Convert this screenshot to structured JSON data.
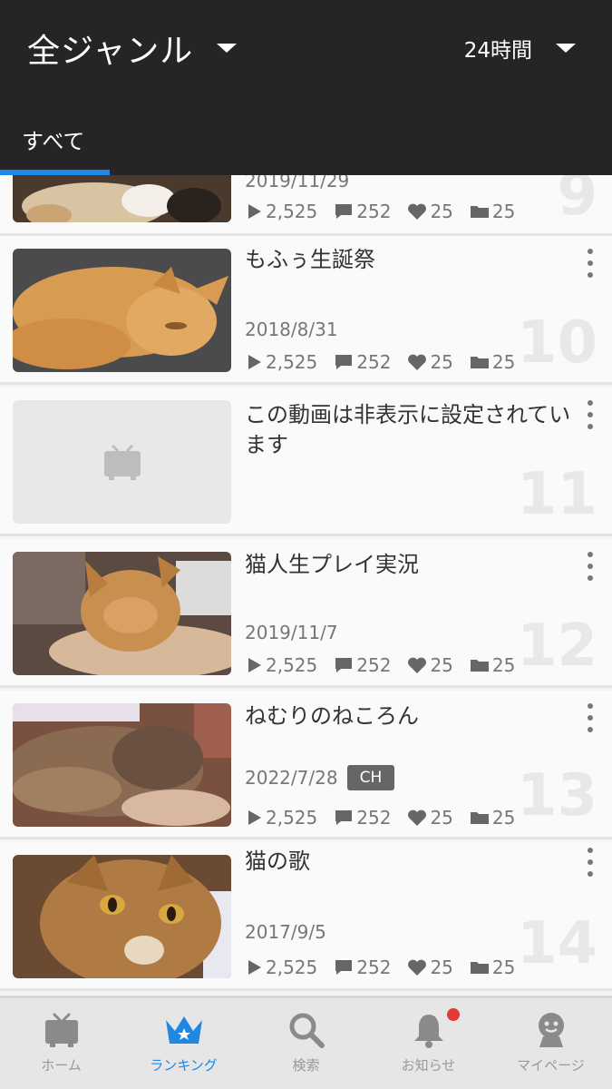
{
  "header": {
    "genre": "全ジャンル",
    "period": "24時間",
    "tab_all": "すべて"
  },
  "items": [
    {
      "rank": "9",
      "title": "",
      "date": "2019/11/29",
      "views": "2,525",
      "comments": "252",
      "likes": "25",
      "mylists": "25"
    },
    {
      "rank": "10",
      "title": "もふぅ生誕祭",
      "date": "2018/8/31",
      "views": "2,525",
      "comments": "252",
      "likes": "25",
      "mylists": "25"
    },
    {
      "rank": "11",
      "title": "この動画は非表示に設定されています"
    },
    {
      "rank": "12",
      "title": "猫人生プレイ実況",
      "date": "2019/11/7",
      "views": "2,525",
      "comments": "252",
      "likes": "25",
      "mylists": "25"
    },
    {
      "rank": "13",
      "title": "ねむりのねころん",
      "date": "2022/7/28",
      "badge": "CH",
      "views": "2,525",
      "comments": "252",
      "likes": "25",
      "mylists": "25"
    },
    {
      "rank": "14",
      "title": "猫の歌",
      "date": "2017/9/5",
      "views": "2,525",
      "comments": "252",
      "likes": "25",
      "mylists": "25"
    }
  ],
  "nav": {
    "home": "ホーム",
    "ranking": "ランキング",
    "search": "検索",
    "notifications": "お知らせ",
    "mypage": "マイページ"
  },
  "colors": {
    "header_bg": "#252525",
    "accent": "#1e88e5",
    "notification_dot": "#e53935"
  },
  "icons": [
    "play-icon",
    "comment-icon",
    "heart-icon",
    "folder-icon",
    "tv-icon",
    "crown-icon",
    "search-icon",
    "bell-icon",
    "user-icon"
  ]
}
